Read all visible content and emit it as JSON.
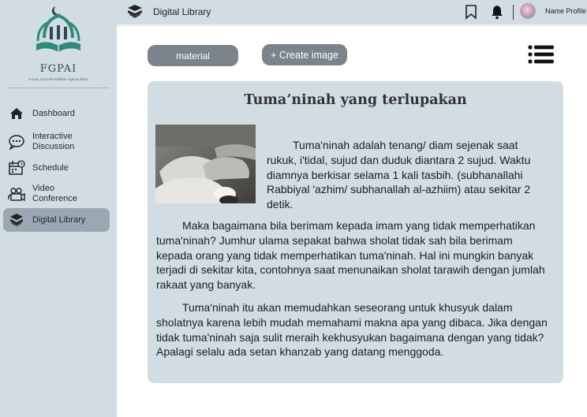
{
  "sidebar": {
    "logo": {
      "name": "FGPAI",
      "tagline": "Forum Guru Pendidikan Agama Islam"
    },
    "items": [
      {
        "label": "Dashboard",
        "icon": "home-icon",
        "active": false
      },
      {
        "label": "Interactive\nDiscussion",
        "icon": "chat-icon",
        "active": false
      },
      {
        "label": "Schedule",
        "icon": "calendar-icon",
        "active": false
      },
      {
        "label": "Video\nConference",
        "icon": "video-icon",
        "active": false
      },
      {
        "label": "Digital Library",
        "icon": "books-icon",
        "active": true
      }
    ]
  },
  "topbar": {
    "title": "Digital Library",
    "icons": [
      "books-icon",
      "bookmark-icon",
      "bell-icon"
    ],
    "profile_name": "Name Profile"
  },
  "toolbar": {
    "material_label": "material",
    "create_label": "+ Create image",
    "menu_icon": "list-menu-icon"
  },
  "article": {
    "title": "Tuma’ninah yang terlupakan",
    "paragraphs": [
      "Tuma'ninah adalah tenang/ diam sejenak saat rukuk, i'tidal, sujud dan duduk diantara 2 sujud. Waktu diamnya berkisar selama 1 kali tasbih. (subhanallahi Rabbiyal 'azhim/ subhanallah al-azhiim) atau sekitar 2 detik.",
      "Maka bagaimana bila berimam kepada imam yang tidak memperhatikan tuma'ninah? Jumhur ulama sepakat bahwa sholat tidak sah bila berimam kepada orang yang tidak memperhatikan tuma'ninah. Hal ini mungkin banyak terjadi di sekitar kita, contohnya saat menunaikan sholat tarawih dengan jumlah rakaat yang banyak.",
      "Tuma'ninah itu akan memudahkan seseorang untuk khusyuk dalam sholatnya karena lebih mudah memahami makna apa yang dibaca. Jika dengan tidak tuma'ninah saja sulit meraih kekhusyukan bagaimana dengan yang tidak? Apalagi selalu ada setan khanzab yang datang menggoda."
    ]
  },
  "colors": {
    "sidebar_bg": "#d2dde3",
    "active_item": "#9ba7b2",
    "button": "#7b838b",
    "card_bg": "#d2dde3"
  }
}
